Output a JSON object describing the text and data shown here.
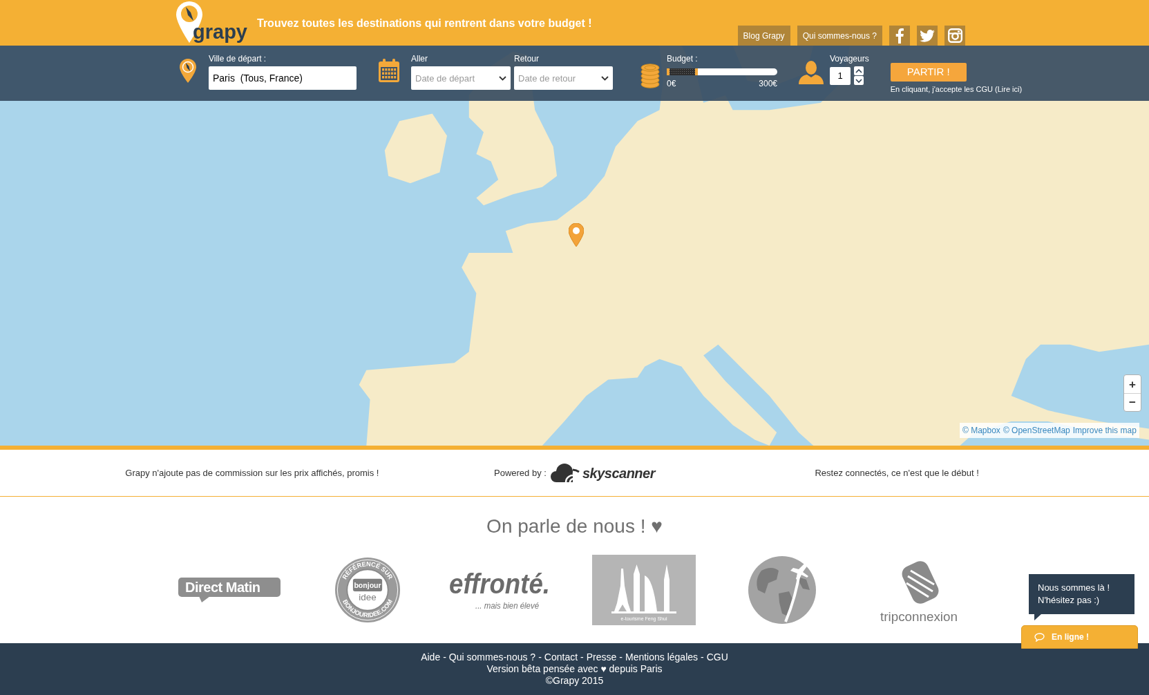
{
  "header": {
    "logo": "grapy",
    "tagline": "Trouvez toutes les destinations qui rentrent dans votre budget !",
    "nav_links": [
      {
        "label": "Blog Grapy"
      },
      {
        "label": "Qui sommes-nous ?"
      }
    ],
    "social_links": [
      {
        "kind": "facebook"
      },
      {
        "kind": "twitter"
      },
      {
        "kind": "instagram"
      }
    ]
  },
  "search": {
    "departure": {
      "label": "Ville de départ :",
      "value": "Paris  (Tous, France)"
    },
    "outbound_date": {
      "label": "Aller",
      "placeholder": "Date de départ"
    },
    "return_date": {
      "label": "Retour",
      "placeholder": "Date de retour"
    },
    "budget": {
      "label": "Budget :",
      "level": 0.28,
      "min_label": "0€",
      "max_label": "300€"
    },
    "travelers": {
      "label": "Voyageurs",
      "value": "1"
    },
    "submit": {
      "label": "PARTIR !"
    },
    "terms_note": "En cliquant, j'accepte les CGU (Lire ici)"
  },
  "map": {
    "zoom_controls": [
      {
        "label": "+"
      },
      {
        "label": "−"
      }
    ],
    "attribution_links": [
      "© Mapbox",
      "© OpenStreetMap",
      "Improve this map"
    ]
  },
  "info_strip": {
    "left_text": "Grapy n'ajoute pas de commission sur les prix affichés, promis !",
    "powered_by": "Powered by :",
    "partner_logo": "skyscanner",
    "right_text": "Restez connectés, ce n'est que le début !"
  },
  "press": {
    "title": "On parle de nous ! ♥",
    "logos": [
      {
        "kind": "speech-badge",
        "texts": [
          "Direct Matin"
        ]
      },
      {
        "kind": "seal",
        "texts": [
          "RÉFÉRENCÉ SUR",
          "bonjour",
          "idee",
          "BONJOURIDEE.COM"
        ]
      },
      {
        "kind": "script",
        "texts": [
          "effronté.",
          "... mais bien élevé"
        ]
      },
      {
        "kind": "skyline",
        "texts": [
          "e-tourisme Feng Shui"
        ]
      },
      {
        "kind": "globe"
      },
      {
        "kind": "knot",
        "texts": [
          "tripconnexion"
        ]
      }
    ]
  },
  "chat": {
    "message_lines": [
      "Nous sommes là !",
      "N'hésitez pas :)"
    ],
    "status": "En ligne !"
  },
  "footer": {
    "links": [
      {
        "label": "Aide",
        "separator": "-"
      },
      {
        "label": "Qui sommes-nous ?",
        "separator": "-"
      },
      {
        "label": "Contact",
        "separator": "-"
      },
      {
        "label": "Presse",
        "separator": "-"
      },
      {
        "label": "Mentions légales",
        "separator": "-"
      },
      {
        "label": "CGU"
      }
    ],
    "credit": "Version bêta pensée avec ♥ depuis Paris",
    "copyright": "©Grapy 2015"
  }
}
